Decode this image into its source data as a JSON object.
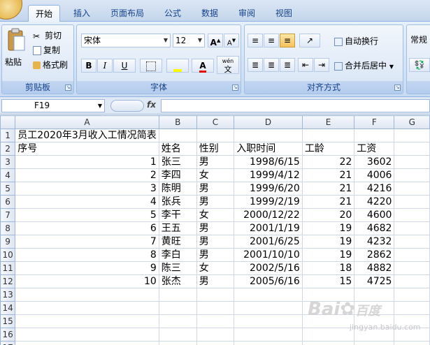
{
  "tabs": [
    "开始",
    "插入",
    "页面布局",
    "公式",
    "数据",
    "审阅",
    "视图"
  ],
  "clipboard": {
    "paste": "粘贴",
    "cut": "剪切",
    "copy": "复制",
    "format_painter": "格式刷",
    "label": "剪贴板"
  },
  "font": {
    "name": "宋体",
    "size": "12",
    "bold": "B",
    "italic": "I",
    "underline": "U",
    "grow": "A",
    "shrink": "A",
    "label": "字体",
    "phonetic": "wén"
  },
  "align": {
    "wrap": "自动换行",
    "merge": "合并后居中",
    "label": "对齐方式"
  },
  "number": {
    "format": "常规"
  },
  "namebox": "F19",
  "fx": "fx",
  "columns": [
    "A",
    "B",
    "C",
    "D",
    "E",
    "F",
    "G"
  ],
  "rows": [
    {
      "n": "1",
      "cells": [
        "员工2020年3月收入工情况简表",
        "",
        "",
        "",
        "",
        "",
        ""
      ]
    },
    {
      "n": "2",
      "cells": [
        "序号",
        "姓名",
        "性别",
        "入职时间",
        "工龄",
        "工资",
        ""
      ]
    },
    {
      "n": "3",
      "cells": [
        "1",
        "张三",
        "男",
        "1998/6/15",
        "22",
        "3602",
        ""
      ]
    },
    {
      "n": "4",
      "cells": [
        "2",
        "李四",
        "女",
        "1999/4/12",
        "21",
        "4006",
        ""
      ]
    },
    {
      "n": "5",
      "cells": [
        "3",
        "陈明",
        "男",
        "1999/6/20",
        "21",
        "4216",
        ""
      ]
    },
    {
      "n": "6",
      "cells": [
        "4",
        "张兵",
        "男",
        "1999/2/19",
        "21",
        "4220",
        ""
      ]
    },
    {
      "n": "7",
      "cells": [
        "5",
        "李干",
        "女",
        "2000/12/22",
        "20",
        "4600",
        ""
      ]
    },
    {
      "n": "8",
      "cells": [
        "6",
        "王五",
        "男",
        "2001/1/19",
        "19",
        "4682",
        ""
      ]
    },
    {
      "n": "9",
      "cells": [
        "7",
        "黄旺",
        "男",
        "2001/6/25",
        "19",
        "4232",
        ""
      ]
    },
    {
      "n": "10",
      "cells": [
        "8",
        "李白",
        "男",
        "2001/10/10",
        "19",
        "2862",
        ""
      ]
    },
    {
      "n": "11",
      "cells": [
        "9",
        "陈三",
        "女",
        "2002/5/16",
        "18",
        "4882",
        ""
      ]
    },
    {
      "n": "12",
      "cells": [
        "10",
        "张杰",
        "男",
        "2005/6/16",
        "15",
        "4725",
        ""
      ]
    },
    {
      "n": "13",
      "cells": [
        "",
        "",
        "",
        "",
        "",
        "",
        ""
      ]
    },
    {
      "n": "14",
      "cells": [
        "",
        "",
        "",
        "",
        "",
        "",
        ""
      ]
    },
    {
      "n": "15",
      "cells": [
        "",
        "",
        "",
        "",
        "",
        "",
        ""
      ]
    },
    {
      "n": "16",
      "cells": [
        "",
        "",
        "",
        "",
        "",
        "",
        ""
      ]
    },
    {
      "n": "17",
      "cells": [
        "",
        "",
        "",
        "",
        "",
        "",
        ""
      ]
    }
  ],
  "watermark": {
    "logo": "Bai",
    "logo2": "百度",
    "sub": "jingyan.baidu.com"
  }
}
